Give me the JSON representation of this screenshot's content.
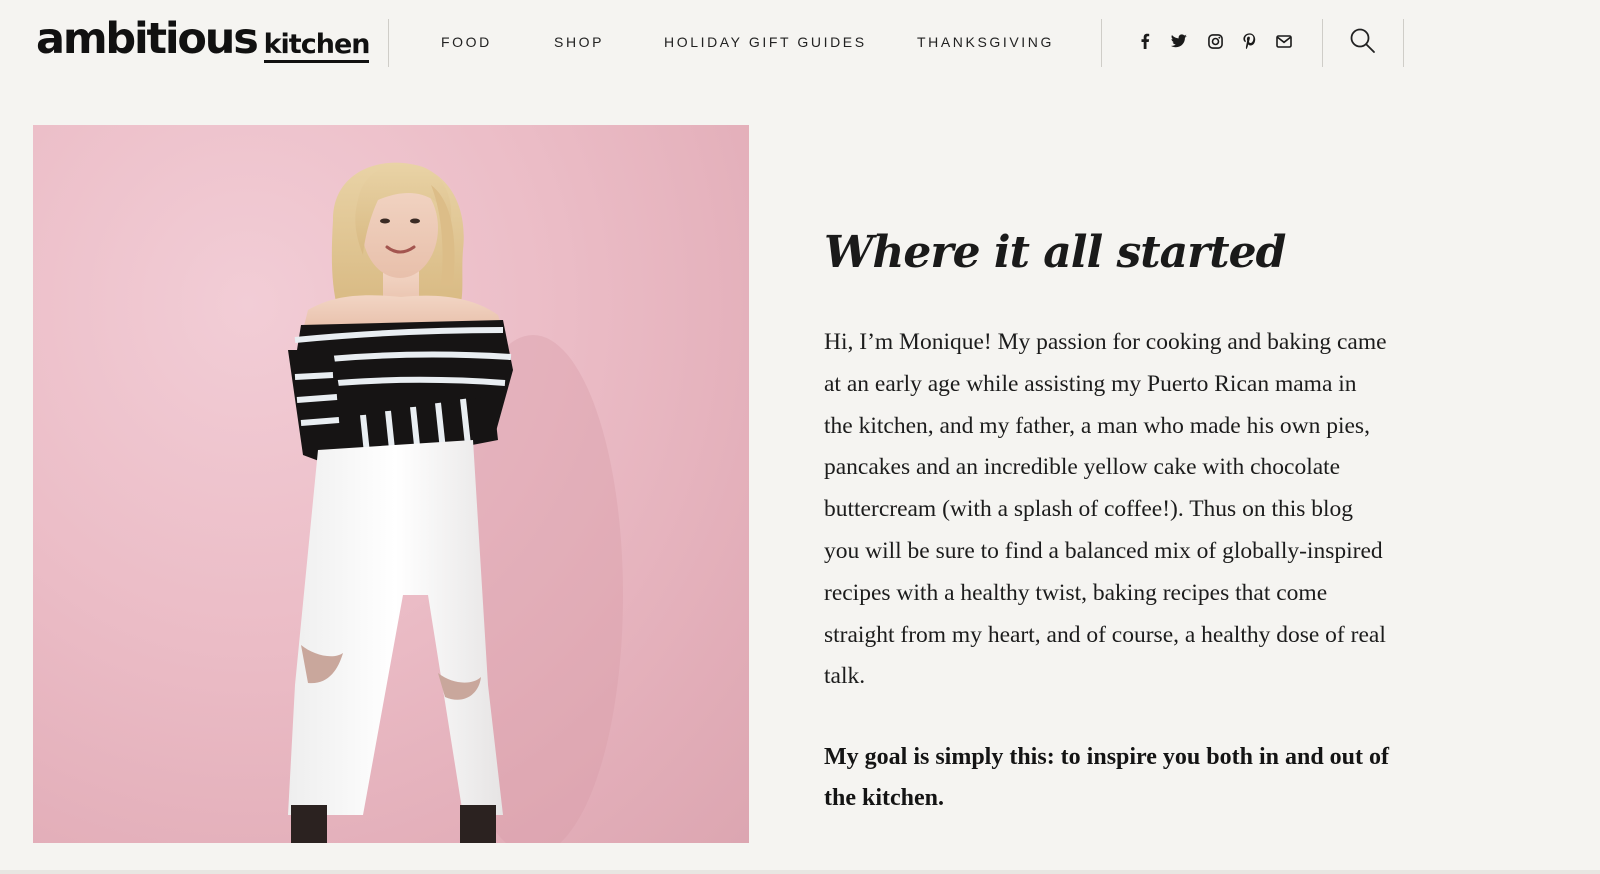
{
  "logo": {
    "main": "ambitious",
    "sub": "kitchen"
  },
  "nav": {
    "items": [
      {
        "label": "FOOD"
      },
      {
        "label": "SHOP"
      },
      {
        "label": "HOLIDAY GIFT GUIDES"
      },
      {
        "label": "THANKSGIVING"
      }
    ]
  },
  "social": {
    "icons": [
      "facebook-icon",
      "twitter-icon",
      "instagram-icon",
      "pinterest-icon",
      "email-icon"
    ]
  },
  "search": {
    "icon": "search-icon"
  },
  "photo": {
    "subject": "woman-portrait-icon",
    "background_color": "#ebbcc6"
  },
  "about": {
    "heading": "Where it all started",
    "intro": "Hi, I’m Monique! My passion for cooking and baking came at an early age while assisting my Puerto Rican mama in the kitchen, and my father, a man who made his own pies, pancakes and an incredible yellow cake with chocolate buttercream (with a splash of coffee!). Thus on this blog you will be sure to find a balanced mix of globally-inspired recipes with a healthy twist, baking recipes that come straight from my heart, and of course, a healthy dose of real talk.",
    "goal": "My goal is simply this: to inspire you both in and out of the kitchen."
  },
  "colors": {
    "page_bg": "#f5f4f1",
    "text": "#111111",
    "photo_pink": "#ebbcc6",
    "divider": "#cfcdc8"
  }
}
